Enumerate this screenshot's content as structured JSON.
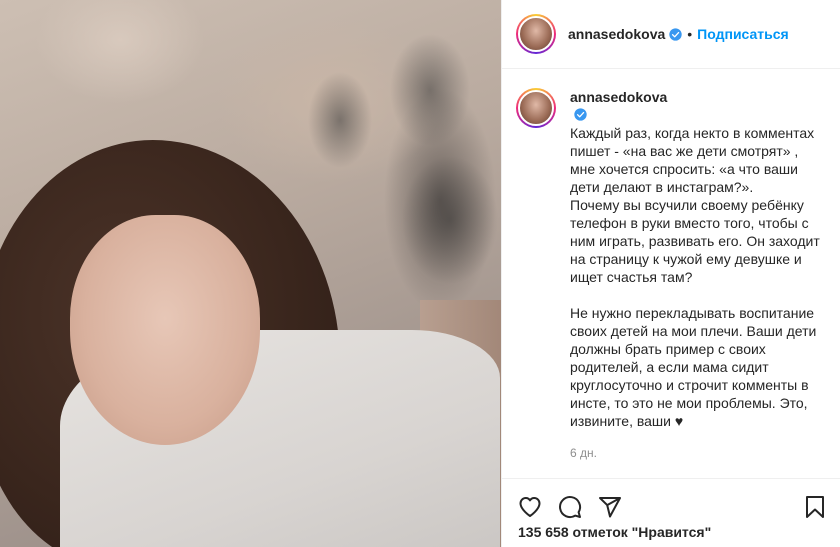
{
  "post": {
    "username": "annasedokova",
    "follow_label": "Подписаться",
    "separator": "•",
    "caption": "Каждый раз, когда некто в комментах пишет - «на вас же дети смотрят» , мне хочется спросить: «а что ваши дети делают в инстаграм?».\nПочему вы всучили своему рeбёнку телефон в руки вместо того, чтобы с ним играть, развивать его. Он заходит на страницу к чужой ему девушке и ищет счастья там?\n\nНе нужно перекладывать воспитание своих детей на мои плечи. Ваши дети должны брать пример с своих родителей, а если мама сидит круглосуточно и строчит комменты в инсте, то это не мои проблемы. Это, извините, ваши ♥",
    "time_ago": "6 дн.",
    "likes_count": "135 658",
    "likes_text": "отметок \"Нравится\""
  },
  "icons": {
    "like": "heart-icon",
    "comment": "comment-icon",
    "share": "share-icon",
    "save": "bookmark-icon",
    "verified": "verified-badge-icon"
  },
  "colors": {
    "link_blue": "#0095f6",
    "verified_blue": "#3897f0",
    "muted": "#8e8e8e",
    "text": "#262626"
  }
}
